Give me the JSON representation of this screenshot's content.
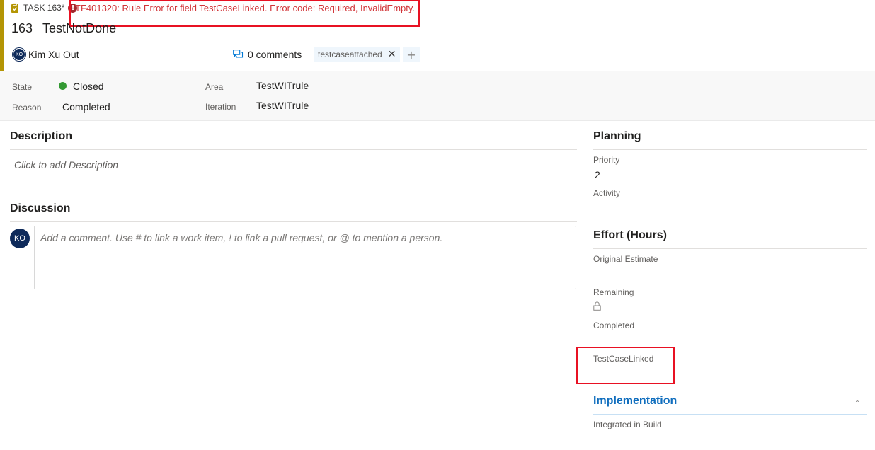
{
  "header": {
    "task_label": "TASK 163*",
    "error_message": "TF401320: Rule Error for field TestCaseLinked. Error code: Required, InvalidEmpty.",
    "work_item_id": "163",
    "title": "TestNotDone",
    "assignee_initials": "KO",
    "assignee_name": "Kim Xu Out",
    "comments_label": "0 comments",
    "tag": "testcaseattached",
    "accent_color": "#b49504",
    "error_color": "#d13438"
  },
  "fields": {
    "state_label": "State",
    "state_value": "Closed",
    "state_color": "#339933",
    "reason_label": "Reason",
    "reason_value": "Completed",
    "area_label": "Area",
    "area_value": "TestWITrule",
    "iteration_label": "Iteration",
    "iteration_value": "TestWITrule"
  },
  "description": {
    "title": "Description",
    "placeholder": "Click to add Description"
  },
  "discussion": {
    "title": "Discussion",
    "avatar_initials": "KO",
    "placeholder": "Add a comment. Use # to link a work item, ! to link a pull request, or @ to mention a person."
  },
  "planning": {
    "title": "Planning",
    "priority_label": "Priority",
    "priority_value": "2",
    "activity_label": "Activity"
  },
  "effort": {
    "title": "Effort (Hours)",
    "original_estimate_label": "Original Estimate",
    "remaining_label": "Remaining",
    "completed_label": "Completed",
    "test_case_linked_label": "TestCaseLinked"
  },
  "implementation": {
    "title": "Implementation",
    "integrated_label": "Integrated in Build"
  }
}
